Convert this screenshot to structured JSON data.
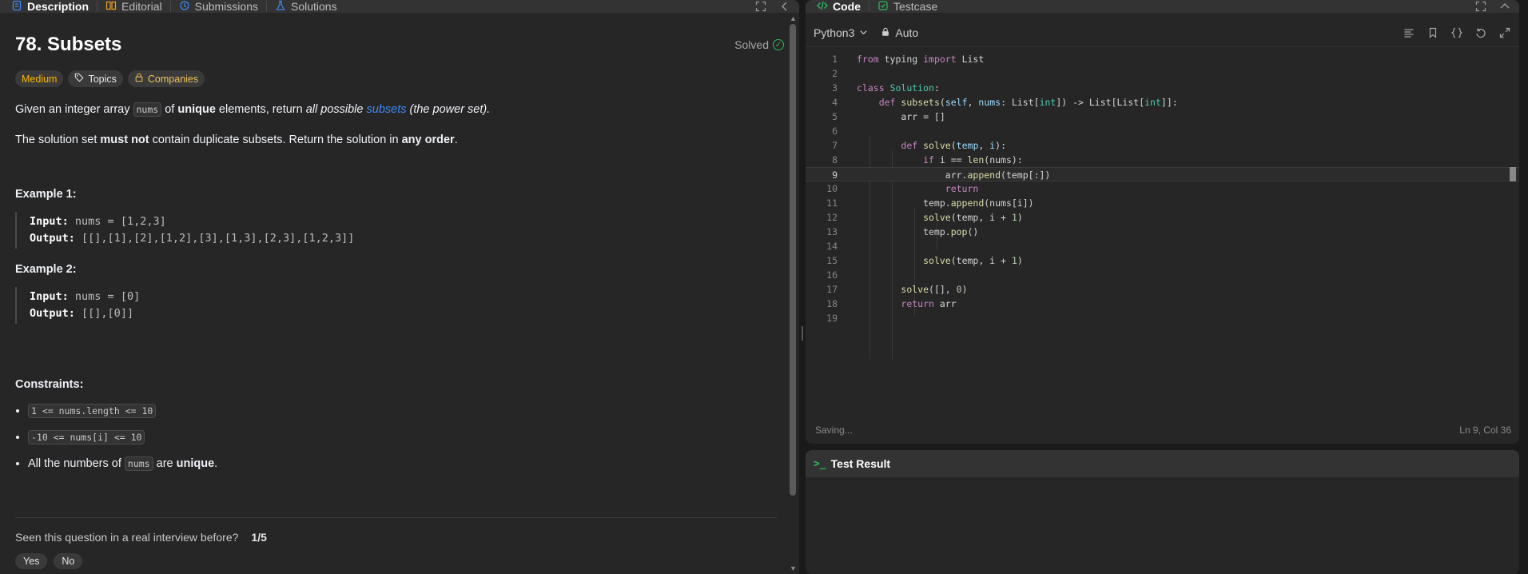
{
  "left_tabs": [
    {
      "label": "Description",
      "icon": "document-icon",
      "active": true
    },
    {
      "label": "Editorial",
      "icon": "book-icon",
      "active": false
    },
    {
      "label": "Submissions",
      "icon": "history-icon",
      "active": false
    },
    {
      "label": "Solutions",
      "icon": "flask-icon",
      "active": false
    }
  ],
  "problem": {
    "title": "78. Subsets",
    "status": "Solved",
    "badges": {
      "difficulty": "Medium",
      "topics": "Topics",
      "companies": "Companies"
    },
    "intro_1": "Given an integer array ",
    "intro_code": "nums",
    "intro_2": " of ",
    "intro_bold": "unique",
    "intro_3": " elements, return ",
    "intro_italic": "all possible",
    "intro_link": "subsets",
    "intro_4": "(the power set).",
    "para2_a": "The solution set ",
    "para2_bold": "must not",
    "para2_b": " contain duplicate subsets. Return the solution in ",
    "para2_bold2": "any order",
    "para2_c": ".",
    "examples": [
      {
        "title": "Example 1:",
        "input_label": "Input:",
        "input": "nums = [1,2,3]",
        "output_label": "Output:",
        "output": "[[],[1],[2],[1,2],[3],[1,3],[2,3],[1,2,3]]"
      },
      {
        "title": "Example 2:",
        "input_label": "Input:",
        "input": "nums = [0]",
        "output_label": "Output:",
        "output": "[[],[0]]"
      }
    ],
    "constraints_title": "Constraints:",
    "constraints": [
      {
        "code": "1 <= nums.length <= 10"
      },
      {
        "code": "-10 <= nums[i] <= 10"
      }
    ],
    "constraint3_a": "All the numbers of ",
    "constraint3_code": "nums",
    "constraint3_b": " are ",
    "constraint3_bold": "unique",
    "constraint3_c": ".",
    "interview_question": "Seen this question in a real interview before?",
    "interview_ratio": "1/5",
    "yes": "Yes",
    "no": "No"
  },
  "code_tabs": [
    {
      "label": "Code",
      "icon": "code-icon",
      "active": true
    },
    {
      "label": "Testcase",
      "icon": "checkbox-icon",
      "active": false
    }
  ],
  "editor": {
    "language": "Python3",
    "mode": "Auto",
    "status_left": "Saving...",
    "status_right": "Ln 9, Col 36",
    "line_numbers": [
      "1",
      "2",
      "3",
      "4",
      "5",
      "6",
      "7",
      "8",
      "9",
      "10",
      "11",
      "12",
      "13",
      "14",
      "15",
      "16",
      "17",
      "18",
      "19"
    ]
  },
  "result": {
    "title": "Test Result"
  },
  "colors": {
    "accent_green": "#2cbb5d",
    "medium": "#ffb800",
    "link": "#3d8bf7"
  }
}
